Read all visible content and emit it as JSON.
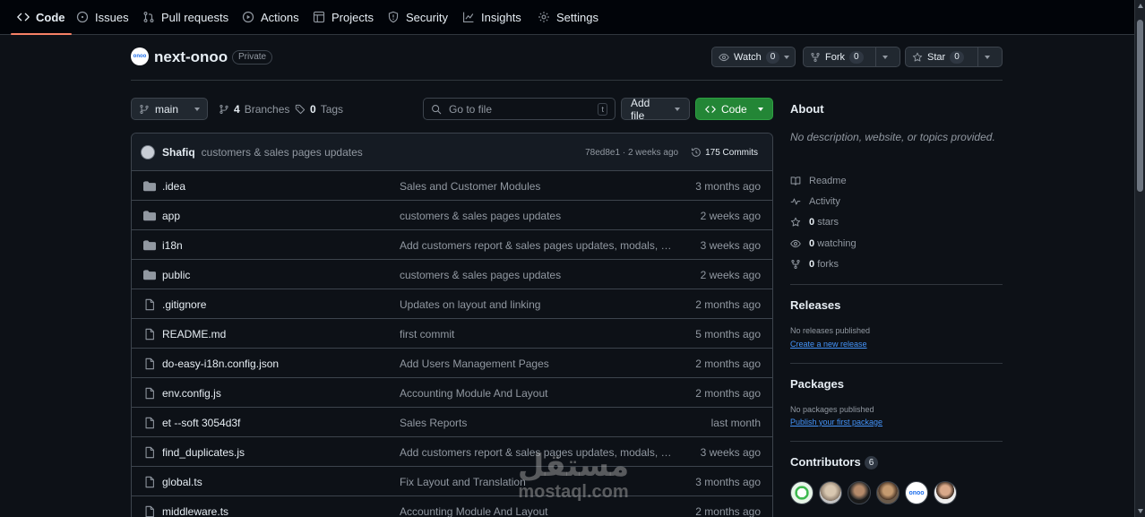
{
  "nav": {
    "code": "Code",
    "issues": "Issues",
    "pulls": "Pull requests",
    "actions": "Actions",
    "projects": "Projects",
    "security": "Security",
    "insights": "Insights",
    "settings": "Settings"
  },
  "repo": {
    "avatar_text": "onoo",
    "name": "next-onoo",
    "visibility": "Private"
  },
  "header_buttons": {
    "watch_label": "Watch",
    "watch_count": "0",
    "fork_label": "Fork",
    "fork_count": "0",
    "star_label": "Star",
    "star_count": "0"
  },
  "toolbar": {
    "branch": "main",
    "branches_count": "4",
    "branches_label": "Branches",
    "tags_count": "0",
    "tags_label": "Tags",
    "goto_placeholder": "Go to file",
    "goto_shortcut": "t",
    "add_file": "Add file",
    "code": "Code"
  },
  "latest_commit": {
    "author": "Shafiq",
    "message": "customers & sales pages updates",
    "hash_age": "78ed8e1 · 2 weeks ago",
    "commits": "175 Commits"
  },
  "files": [
    {
      "type": "folder",
      "name": ".idea",
      "message": "Sales and Customer Modules",
      "date": "3 months ago"
    },
    {
      "type": "folder",
      "name": "app",
      "message": "customers & sales pages updates",
      "date": "2 weeks ago"
    },
    {
      "type": "folder",
      "name": "i18n",
      "message": "Add customers report & sales pages updates, modals, and m…",
      "date": "3 weeks ago"
    },
    {
      "type": "folder",
      "name": "public",
      "message": "customers & sales pages updates",
      "date": "2 weeks ago"
    },
    {
      "type": "file",
      "name": ".gitignore",
      "message": "Updates on layout and linking",
      "date": "2 months ago"
    },
    {
      "type": "file",
      "name": "README.md",
      "message": "first commit",
      "date": "5 months ago"
    },
    {
      "type": "file",
      "name": "do-easy-i18n.config.json",
      "message": "Add Users Management Pages",
      "date": "2 months ago"
    },
    {
      "type": "file",
      "name": "env.config.js",
      "message": "Accounting Module And Layout",
      "date": "2 months ago"
    },
    {
      "type": "file",
      "name": "et --soft 3054d3f",
      "message": "Sales Reports",
      "date": "last month"
    },
    {
      "type": "file",
      "name": "find_duplicates.js",
      "message": "Add customers report & sales pages updates, modals, and m…",
      "date": "3 weeks ago"
    },
    {
      "type": "file",
      "name": "global.ts",
      "message": "Fix Layout and Translation",
      "date": "3 months ago"
    },
    {
      "type": "file",
      "name": "middleware.ts",
      "message": "Accounting Module And Layout",
      "date": "2 months ago"
    }
  ],
  "sidebar": {
    "about_title": "About",
    "about_desc": "No description, website, or topics provided.",
    "readme": "Readme",
    "activity": "Activity",
    "stars_count": "0",
    "stars_label": "stars",
    "watching_count": "0",
    "watching_label": "watching",
    "forks_count": "0",
    "forks_label": "forks",
    "releases_title": "Releases",
    "releases_none": "No releases published",
    "releases_link": "Create a new release",
    "packages_title": "Packages",
    "packages_none": "No packages published",
    "packages_link": "Publish your first package",
    "contributors_title": "Contributors",
    "contributors_count": "6"
  },
  "watermark": {
    "line1": "مستقل",
    "line2": "mostaql.com"
  },
  "colors": {
    "accent_tab": "#f78166",
    "code_button": "#238636",
    "link": "#4493f8"
  }
}
